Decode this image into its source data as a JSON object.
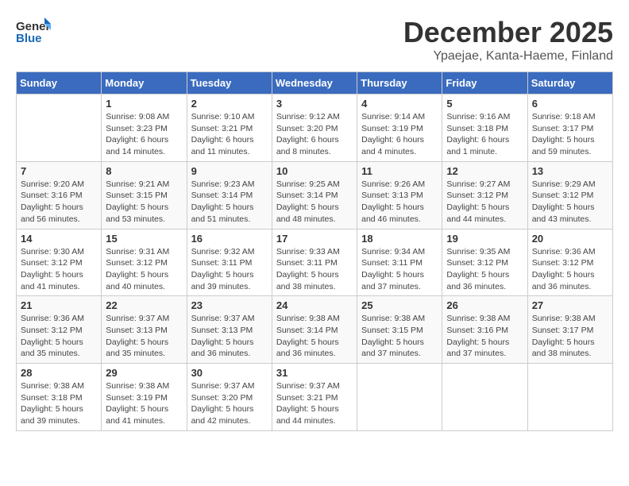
{
  "header": {
    "logo_general": "General",
    "logo_blue": "Blue",
    "month_title": "December 2025",
    "location": "Ypaejae, Kanta-Haeme, Finland"
  },
  "days_of_week": [
    "Sunday",
    "Monday",
    "Tuesday",
    "Wednesday",
    "Thursday",
    "Friday",
    "Saturday"
  ],
  "weeks": [
    [
      {
        "day": "",
        "info": ""
      },
      {
        "day": "1",
        "info": "Sunrise: 9:08 AM\nSunset: 3:23 PM\nDaylight: 6 hours\nand 14 minutes."
      },
      {
        "day": "2",
        "info": "Sunrise: 9:10 AM\nSunset: 3:21 PM\nDaylight: 6 hours\nand 11 minutes."
      },
      {
        "day": "3",
        "info": "Sunrise: 9:12 AM\nSunset: 3:20 PM\nDaylight: 6 hours\nand 8 minutes."
      },
      {
        "day": "4",
        "info": "Sunrise: 9:14 AM\nSunset: 3:19 PM\nDaylight: 6 hours\nand 4 minutes."
      },
      {
        "day": "5",
        "info": "Sunrise: 9:16 AM\nSunset: 3:18 PM\nDaylight: 6 hours\nand 1 minute."
      },
      {
        "day": "6",
        "info": "Sunrise: 9:18 AM\nSunset: 3:17 PM\nDaylight: 5 hours\nand 59 minutes."
      }
    ],
    [
      {
        "day": "7",
        "info": "Sunrise: 9:20 AM\nSunset: 3:16 PM\nDaylight: 5 hours\nand 56 minutes."
      },
      {
        "day": "8",
        "info": "Sunrise: 9:21 AM\nSunset: 3:15 PM\nDaylight: 5 hours\nand 53 minutes."
      },
      {
        "day": "9",
        "info": "Sunrise: 9:23 AM\nSunset: 3:14 PM\nDaylight: 5 hours\nand 51 minutes."
      },
      {
        "day": "10",
        "info": "Sunrise: 9:25 AM\nSunset: 3:14 PM\nDaylight: 5 hours\nand 48 minutes."
      },
      {
        "day": "11",
        "info": "Sunrise: 9:26 AM\nSunset: 3:13 PM\nDaylight: 5 hours\nand 46 minutes."
      },
      {
        "day": "12",
        "info": "Sunrise: 9:27 AM\nSunset: 3:12 PM\nDaylight: 5 hours\nand 44 minutes."
      },
      {
        "day": "13",
        "info": "Sunrise: 9:29 AM\nSunset: 3:12 PM\nDaylight: 5 hours\nand 43 minutes."
      }
    ],
    [
      {
        "day": "14",
        "info": "Sunrise: 9:30 AM\nSunset: 3:12 PM\nDaylight: 5 hours\nand 41 minutes."
      },
      {
        "day": "15",
        "info": "Sunrise: 9:31 AM\nSunset: 3:12 PM\nDaylight: 5 hours\nand 40 minutes."
      },
      {
        "day": "16",
        "info": "Sunrise: 9:32 AM\nSunset: 3:11 PM\nDaylight: 5 hours\nand 39 minutes."
      },
      {
        "day": "17",
        "info": "Sunrise: 9:33 AM\nSunset: 3:11 PM\nDaylight: 5 hours\nand 38 minutes."
      },
      {
        "day": "18",
        "info": "Sunrise: 9:34 AM\nSunset: 3:11 PM\nDaylight: 5 hours\nand 37 minutes."
      },
      {
        "day": "19",
        "info": "Sunrise: 9:35 AM\nSunset: 3:12 PM\nDaylight: 5 hours\nand 36 minutes."
      },
      {
        "day": "20",
        "info": "Sunrise: 9:36 AM\nSunset: 3:12 PM\nDaylight: 5 hours\nand 36 minutes."
      }
    ],
    [
      {
        "day": "21",
        "info": "Sunrise: 9:36 AM\nSunset: 3:12 PM\nDaylight: 5 hours\nand 35 minutes."
      },
      {
        "day": "22",
        "info": "Sunrise: 9:37 AM\nSunset: 3:13 PM\nDaylight: 5 hours\nand 35 minutes."
      },
      {
        "day": "23",
        "info": "Sunrise: 9:37 AM\nSunset: 3:13 PM\nDaylight: 5 hours\nand 36 minutes."
      },
      {
        "day": "24",
        "info": "Sunrise: 9:38 AM\nSunset: 3:14 PM\nDaylight: 5 hours\nand 36 minutes."
      },
      {
        "day": "25",
        "info": "Sunrise: 9:38 AM\nSunset: 3:15 PM\nDaylight: 5 hours\nand 37 minutes."
      },
      {
        "day": "26",
        "info": "Sunrise: 9:38 AM\nSunset: 3:16 PM\nDaylight: 5 hours\nand 37 minutes."
      },
      {
        "day": "27",
        "info": "Sunrise: 9:38 AM\nSunset: 3:17 PM\nDaylight: 5 hours\nand 38 minutes."
      }
    ],
    [
      {
        "day": "28",
        "info": "Sunrise: 9:38 AM\nSunset: 3:18 PM\nDaylight: 5 hours\nand 39 minutes."
      },
      {
        "day": "29",
        "info": "Sunrise: 9:38 AM\nSunset: 3:19 PM\nDaylight: 5 hours\nand 41 minutes."
      },
      {
        "day": "30",
        "info": "Sunrise: 9:37 AM\nSunset: 3:20 PM\nDaylight: 5 hours\nand 42 minutes."
      },
      {
        "day": "31",
        "info": "Sunrise: 9:37 AM\nSunset: 3:21 PM\nDaylight: 5 hours\nand 44 minutes."
      },
      {
        "day": "",
        "info": ""
      },
      {
        "day": "",
        "info": ""
      },
      {
        "day": "",
        "info": ""
      }
    ]
  ]
}
